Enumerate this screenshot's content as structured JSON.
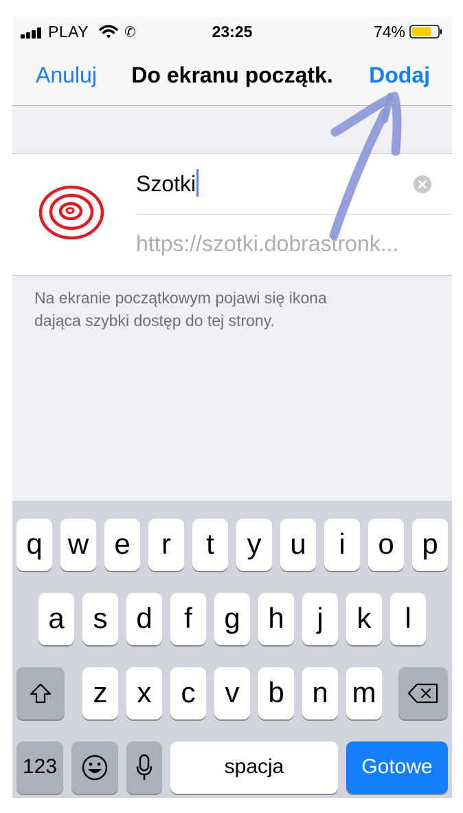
{
  "status_bar": {
    "carrier": "PLAY",
    "time": "23:25",
    "battery_percent": "74%",
    "battery_level": 0.74,
    "battery_color": "#ffcc00"
  },
  "nav": {
    "cancel_label": "Anuluj",
    "title": "Do ekranu początk.",
    "add_label": "Dodaj"
  },
  "form": {
    "name_value": "Szotki",
    "url_text": "https://szotki.dobrastronk...",
    "icon": "target-icon",
    "clear_icon": "clear-icon"
  },
  "info_text_line1": "Na ekranie początkowym pojawi się ikona",
  "info_text_line2": "dająca szybki dostęp do tej strony.",
  "keyboard": {
    "row1": [
      "q",
      "w",
      "e",
      "r",
      "t",
      "y",
      "u",
      "i",
      "o",
      "p"
    ],
    "row2": [
      "a",
      "s",
      "d",
      "f",
      "g",
      "h",
      "j",
      "k",
      "l"
    ],
    "row3": [
      "z",
      "x",
      "c",
      "v",
      "b",
      "n",
      "m"
    ],
    "numbers_label": "123",
    "space_label": "spacja",
    "done_label": "Gotowe",
    "shift_icon": "shift-icon",
    "delete_icon": "backspace-icon",
    "emoji_icon": "emoji-icon",
    "mic_icon": "microphone-icon"
  },
  "colors": {
    "accent": "#157efb",
    "annotation_arrow": "#8b96d6"
  }
}
